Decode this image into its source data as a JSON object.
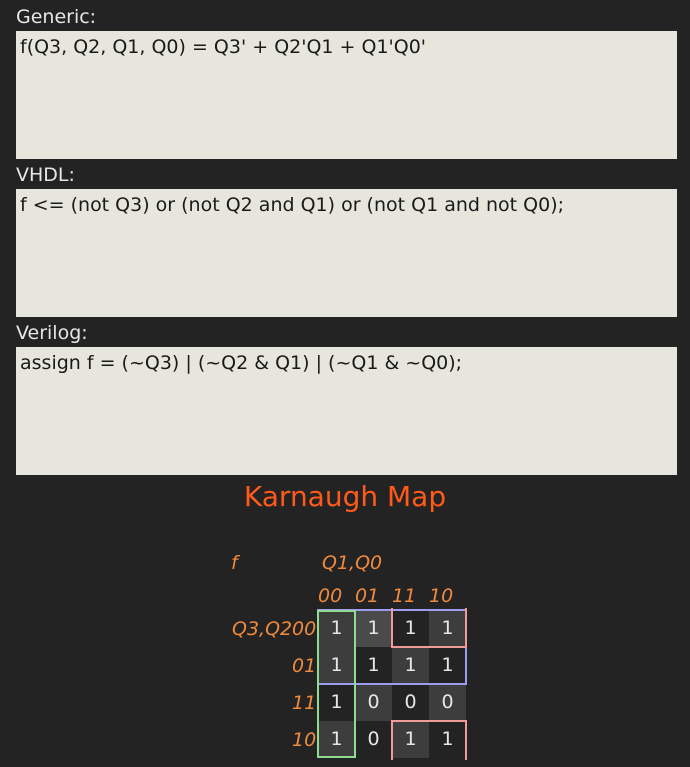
{
  "sections": {
    "generic": {
      "label": "Generic:",
      "code": "f(Q3, Q2, Q1, Q0) = Q3' + Q2'Q1 + Q1'Q0'"
    },
    "vhdl": {
      "label": "VHDL:",
      "code": "f <= (not Q3) or (not Q2 and Q1) or (not Q1 and not Q0);"
    },
    "verilog": {
      "label": "Verilog:",
      "code": "assign f = (~Q3) | (~Q2 & Q1) | (~Q1 & ~Q0);"
    }
  },
  "kmap": {
    "title": "Karnaugh Map",
    "function_name": "f",
    "col_vars": "Q1,Q0",
    "row_vars": "Q3,Q2",
    "col_headers": [
      "00",
      "01",
      "11",
      "10"
    ],
    "row_headers": [
      "00",
      "01",
      "11",
      "10"
    ],
    "cells": [
      [
        "1",
        "1",
        "1",
        "1"
      ],
      [
        "1",
        "1",
        "1",
        "1"
      ],
      [
        "1",
        "0",
        "0",
        "0"
      ],
      [
        "1",
        "0",
        "1",
        "1"
      ]
    ],
    "colors": {
      "title": "#ff5a1a",
      "labels": "#f08a3c",
      "group_blue": "#9c9cf0",
      "group_green": "#8fdc8f",
      "group_red": "#f09a9a"
    }
  }
}
